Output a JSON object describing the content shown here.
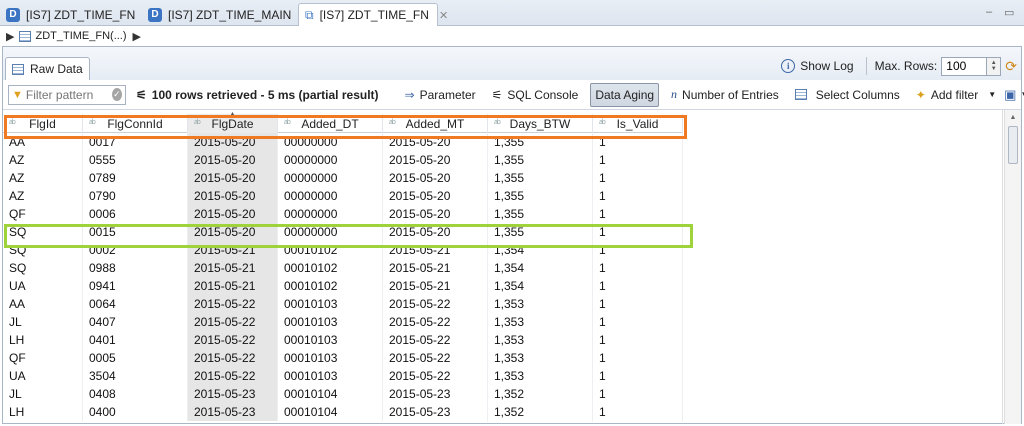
{
  "editor_tabs": [
    {
      "label": "[IS7] ZDT_TIME_FN",
      "icon": "D"
    },
    {
      "label": "[IS7] ZDT_TIME_MAIN",
      "icon": "D"
    },
    {
      "label": "[IS7] ZDT_TIME_FN",
      "icon": "sql"
    }
  ],
  "active_tab_close": "✕",
  "window_controls": {
    "minimize": "–",
    "maximize": "▭"
  },
  "breadcrumb": {
    "label": "ZDT_TIME_FN(...)"
  },
  "panel": {
    "tab_label": "Raw Data",
    "show_log_label": "Show Log",
    "max_rows_label": "Max. Rows:",
    "max_rows_value": "100"
  },
  "toolbar": {
    "filter_placeholder": "Filter pattern",
    "status": "100 rows retrieved - 5 ms (partial result)",
    "parameter_label": "Parameter",
    "sql_console_label": "SQL Console",
    "data_aging_label": "Data Aging",
    "number_of_entries_label": "Number of Entries",
    "select_columns_label": "Select Columns",
    "add_filter_label": "Add filter"
  },
  "table": {
    "columns": [
      "FlgId",
      "FlgConnId",
      "FlgDate",
      "Added_DT",
      "Added_MT",
      "Days_BTW",
      "Is_Valid"
    ],
    "sorted_column": "FlgDate",
    "rows": [
      [
        "AA",
        "0017",
        "2015-05-20",
        "00000000",
        "2015-05-20",
        "1,355",
        "1"
      ],
      [
        "AZ",
        "0555",
        "2015-05-20",
        "00000000",
        "2015-05-20",
        "1,355",
        "1"
      ],
      [
        "AZ",
        "0789",
        "2015-05-20",
        "00000000",
        "2015-05-20",
        "1,355",
        "1"
      ],
      [
        "AZ",
        "0790",
        "2015-05-20",
        "00000000",
        "2015-05-20",
        "1,355",
        "1"
      ],
      [
        "QF",
        "0006",
        "2015-05-20",
        "00000000",
        "2015-05-20",
        "1,355",
        "1"
      ],
      [
        "SQ",
        "0015",
        "2015-05-20",
        "00000000",
        "2015-05-20",
        "1,355",
        "1"
      ],
      [
        "SQ",
        "0002",
        "2015-05-21",
        "00010102",
        "2015-05-21",
        "1,354",
        "1"
      ],
      [
        "SQ",
        "0988",
        "2015-05-21",
        "00010102",
        "2015-05-21",
        "1,354",
        "1"
      ],
      [
        "UA",
        "0941",
        "2015-05-21",
        "00010102",
        "2015-05-21",
        "1,354",
        "1"
      ],
      [
        "AA",
        "0064",
        "2015-05-22",
        "00010103",
        "2015-05-22",
        "1,353",
        "1"
      ],
      [
        "JL",
        "0407",
        "2015-05-22",
        "00010103",
        "2015-05-22",
        "1,353",
        "1"
      ],
      [
        "LH",
        "0401",
        "2015-05-22",
        "00010103",
        "2015-05-22",
        "1,353",
        "1"
      ],
      [
        "QF",
        "0005",
        "2015-05-22",
        "00010103",
        "2015-05-22",
        "1,353",
        "1"
      ],
      [
        "UA",
        "3504",
        "2015-05-22",
        "00010103",
        "2015-05-22",
        "1,353",
        "1"
      ],
      [
        "JL",
        "0408",
        "2015-05-23",
        "00010104",
        "2015-05-23",
        "1,352",
        "1"
      ],
      [
        "LH",
        "0400",
        "2015-05-23",
        "00010104",
        "2015-05-23",
        "1,352",
        "1"
      ]
    ]
  },
  "colors": {
    "highlight_orange": "#f07a22",
    "highlight_green": "#9fd33c",
    "accent": "#3c74c4"
  }
}
